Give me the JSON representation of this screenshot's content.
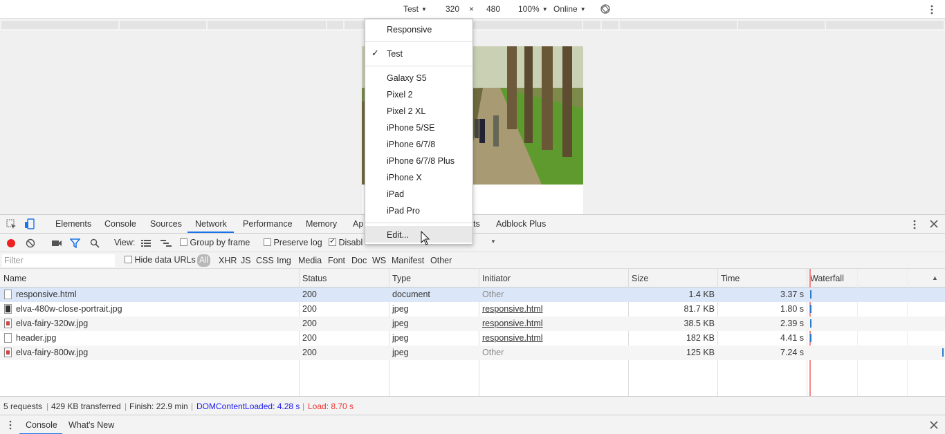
{
  "device_toolbar": {
    "device": "Test",
    "width": "320",
    "x_sep": "×",
    "height": "480",
    "zoom": "100%",
    "throttle": "Online"
  },
  "device_menu": {
    "responsive": "Responsive",
    "selected": "Test",
    "devices": [
      "Galaxy S5",
      "Pixel 2",
      "Pixel 2 XL",
      "iPhone 5/SE",
      "iPhone 6/7/8",
      "iPhone 6/7/8 Plus",
      "iPhone X",
      "iPad",
      "iPad Pro"
    ],
    "edit": "Edit..."
  },
  "panel_tabs": {
    "elements": "Elements",
    "console": "Console",
    "sources": "Sources",
    "network": "Network",
    "performance": "Performance",
    "memory": "Memory",
    "application_partial": "Ap",
    "audits_partial": "ts",
    "adblock": "Adblock Plus"
  },
  "network_toolbar": {
    "view_label": "View:",
    "group_by_frame": "Group by frame",
    "preserve_log": "Preserve log",
    "disable_cache_partial": "Disabl"
  },
  "filter_bar": {
    "placeholder": "Filter",
    "hide_data_urls": "Hide data URLs",
    "types": [
      "All",
      "XHR",
      "JS",
      "CSS",
      "Img",
      "Media",
      "Font",
      "Doc",
      "WS",
      "Manifest",
      "Other"
    ]
  },
  "table": {
    "headers": {
      "name": "Name",
      "status": "Status",
      "type": "Type",
      "initiator": "Initiator",
      "size": "Size",
      "time": "Time",
      "waterfall": "Waterfall"
    },
    "rows": [
      {
        "name": "responsive.html",
        "status": "200",
        "type": "document",
        "initiator": "Other",
        "size": "1.4 KB",
        "time": "3.37 s"
      },
      {
        "name": "elva-480w-close-portrait.jpg",
        "status": "200",
        "type": "jpeg",
        "initiator": "responsive.html",
        "size": "81.7 KB",
        "time": "1.80 s"
      },
      {
        "name": "elva-fairy-320w.jpg",
        "status": "200",
        "type": "jpeg",
        "initiator": "responsive.html",
        "size": "38.5 KB",
        "time": "2.39 s"
      },
      {
        "name": "header.jpg",
        "status": "200",
        "type": "jpeg",
        "initiator": "responsive.html",
        "size": "182 KB",
        "time": "4.41 s"
      },
      {
        "name": "elva-fairy-800w.jpg",
        "status": "200",
        "type": "jpeg",
        "initiator": "Other",
        "size": "125 KB",
        "time": "7.24 s"
      }
    ]
  },
  "status_bar": {
    "requests": "5 requests",
    "transferred": "429 KB transferred",
    "finish": "Finish: 22.9 min",
    "dom_content_loaded": "DOMContentLoaded: 4.28 s",
    "load": "Load: 8.70 s",
    "dcl_color": "#1a1aee",
    "load_color": "#e33"
  },
  "drawer": {
    "console": "Console",
    "whats_new": "What's New"
  }
}
